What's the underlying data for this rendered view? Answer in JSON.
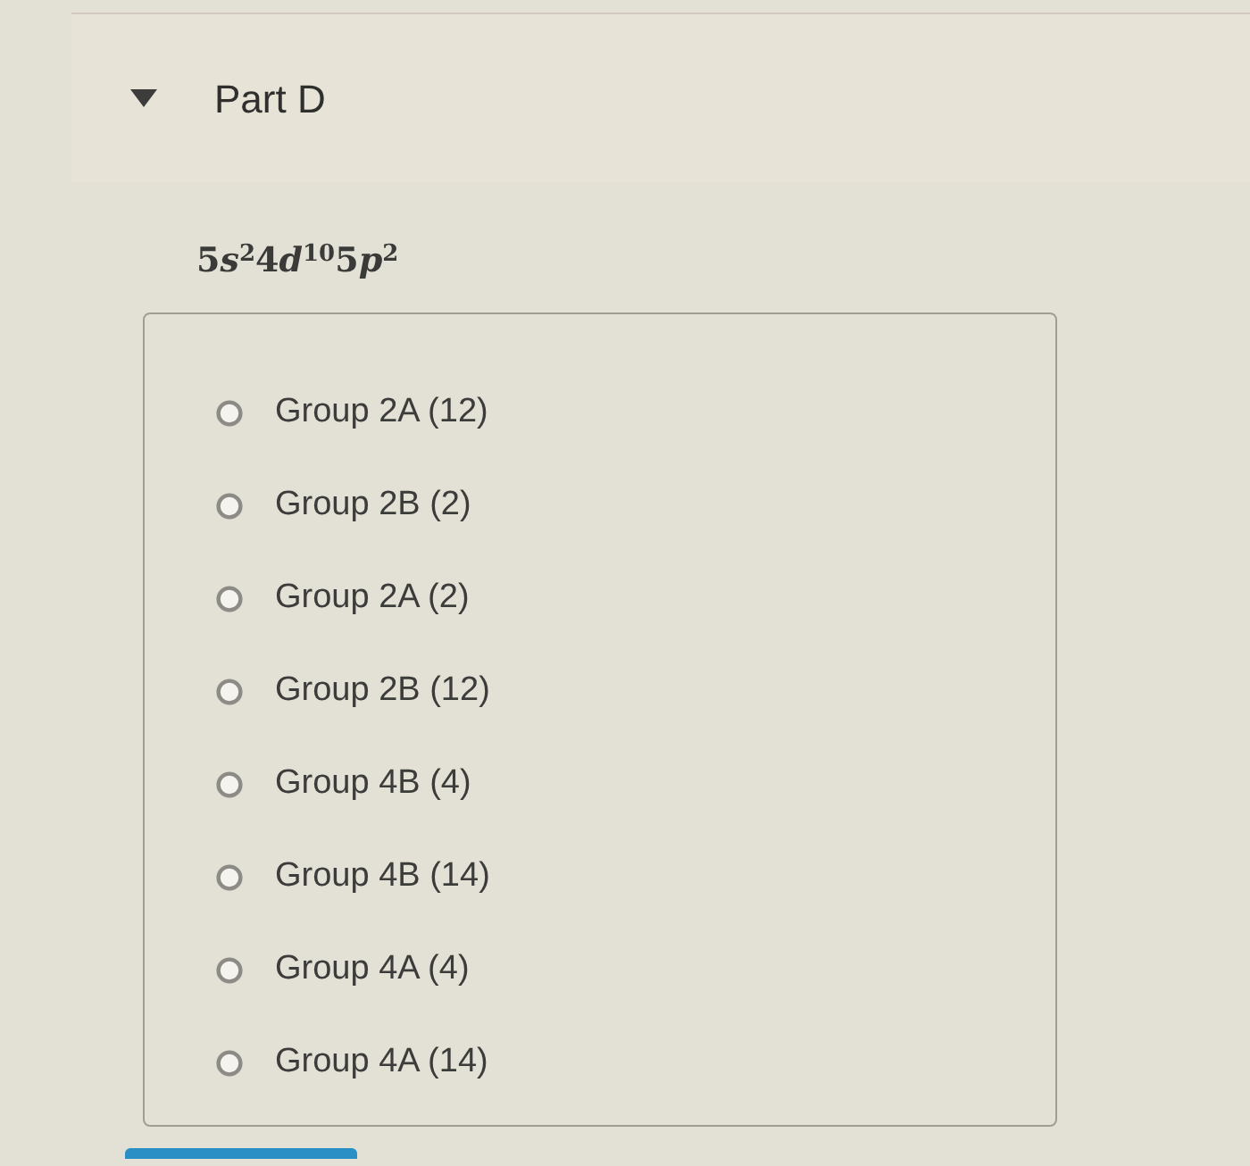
{
  "part": {
    "title": "Part D",
    "expanded": true
  },
  "question": {
    "configuration": [
      {
        "shell": "5",
        "orbital": "s",
        "electrons": "2"
      },
      {
        "shell": "4",
        "orbital": "d",
        "electrons": "10"
      },
      {
        "shell": "5",
        "orbital": "p",
        "electrons": "2"
      }
    ]
  },
  "options": [
    {
      "label": "Group 2A (12)",
      "selected": false
    },
    {
      "label": "Group 2B (2)",
      "selected": false
    },
    {
      "label": "Group 2A (2)",
      "selected": false
    },
    {
      "label": "Group 2B (12)",
      "selected": false
    },
    {
      "label": "Group 4B (4)",
      "selected": false
    },
    {
      "label": "Group 4B (14)",
      "selected": false
    },
    {
      "label": "Group 4A (4)",
      "selected": false
    },
    {
      "label": "Group 4A (14)",
      "selected": false
    }
  ]
}
